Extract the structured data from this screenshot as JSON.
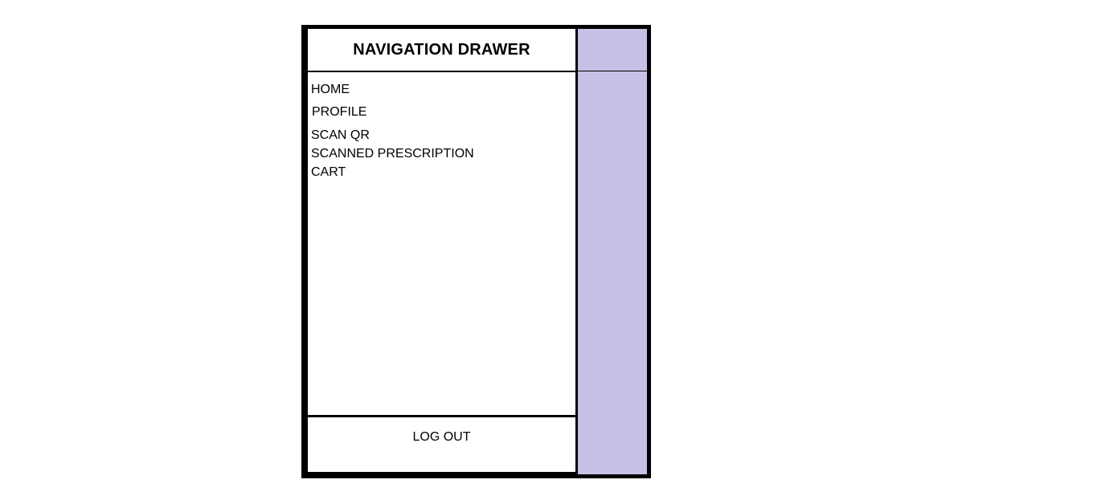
{
  "drawer": {
    "title": "NAVIGATION DRAWER",
    "items": [
      {
        "label": "HOME"
      },
      {
        "label": "PROFILE"
      },
      {
        "label": "SCAN QR"
      },
      {
        "label": "SCANNED PRESCRIPTION"
      },
      {
        "label": "CART"
      }
    ],
    "logout_label": "LOG OUT"
  },
  "colors": {
    "scrim": "#c8c0e6",
    "border": "#000000",
    "background": "#ffffff"
  }
}
